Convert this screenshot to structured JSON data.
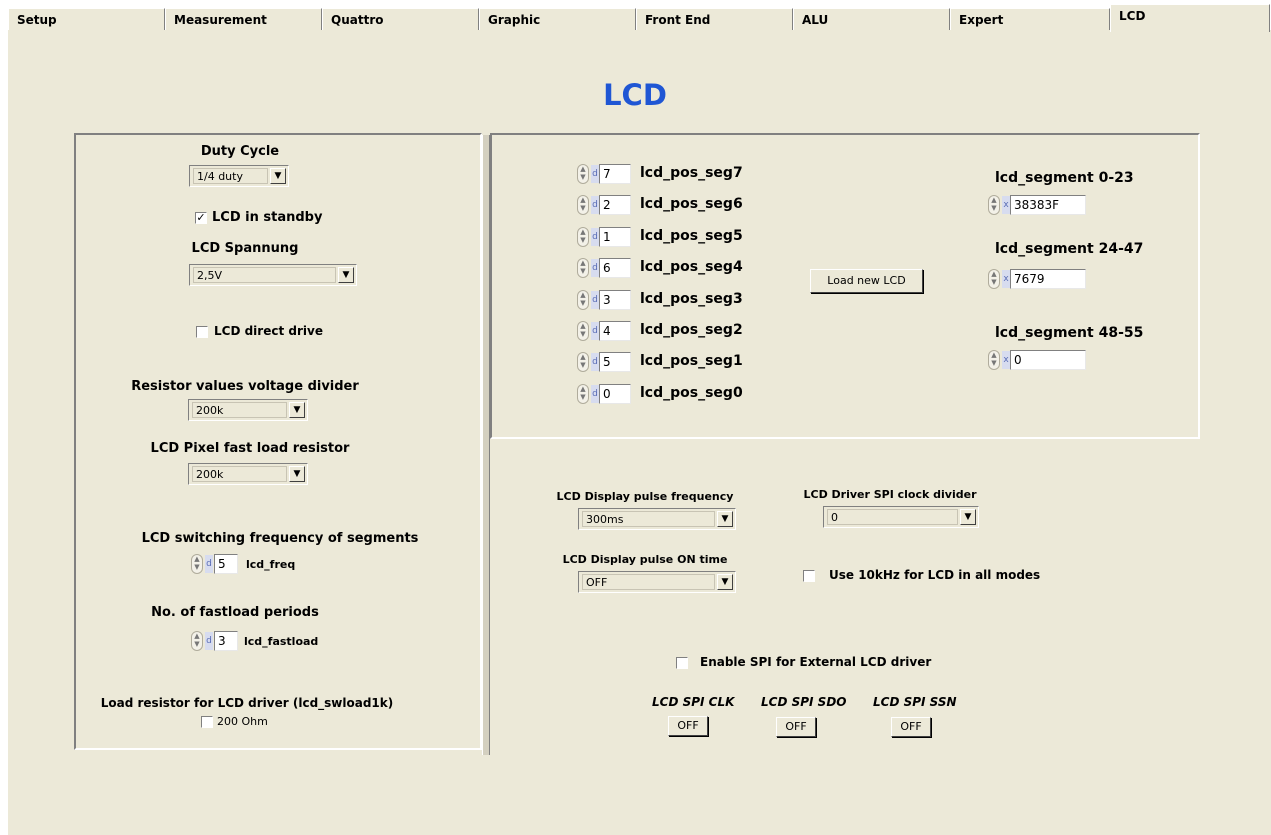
{
  "tabs": [
    {
      "label": "Setup"
    },
    {
      "label": "Measurement"
    },
    {
      "label": "Quattro"
    },
    {
      "label": "Graphic"
    },
    {
      "label": "Front End"
    },
    {
      "label": "ALU"
    },
    {
      "label": "Expert"
    },
    {
      "label": "LCD"
    }
  ],
  "page_title": "LCD",
  "left": {
    "duty_cycle_label": "Duty Cycle",
    "duty_cycle_value": "1/4 duty",
    "standby_label": "LCD in standby",
    "spannung_label": "LCD Spannung",
    "spannung_value": "2,5V",
    "direct_drive_label": "LCD direct drive",
    "resistor_label": "Resistor values voltage divider",
    "resistor_value": "200k",
    "fastload_res_label": "LCD Pixel fast load resistor",
    "fastload_res_value": "200k",
    "switch_freq_label": "LCD switching frequency of segments",
    "freq_value": "5",
    "freq_name": "lcd_freq",
    "fastload_periods_label": "No. of fastload periods",
    "fastload_value": "3",
    "fastload_name": "lcd_fastload",
    "load_res_label": "Load resistor for LCD driver (lcd_swload1k)",
    "ohm_label": "200 Ohm"
  },
  "segments": [
    {
      "value": "7",
      "name": "lcd_pos_seg7"
    },
    {
      "value": "2",
      "name": "lcd_pos_seg6"
    },
    {
      "value": "1",
      "name": "lcd_pos_seg5"
    },
    {
      "value": "6",
      "name": "lcd_pos_seg4"
    },
    {
      "value": "3",
      "name": "lcd_pos_seg3"
    },
    {
      "value": "4",
      "name": "lcd_pos_seg2"
    },
    {
      "value": "5",
      "name": "lcd_pos_seg1"
    },
    {
      "value": "0",
      "name": "lcd_pos_seg0"
    }
  ],
  "radix_dec": "d",
  "radix_hex": "x",
  "load_button": "Load new LCD",
  "seg_regs": [
    {
      "label": "lcd_segment 0-23",
      "value": "38383F"
    },
    {
      "label": "lcd_segment 24-47",
      "value": "7679"
    },
    {
      "label": "lcd_segment 48-55",
      "value": "0"
    }
  ],
  "lower": {
    "pulse_freq_label": "LCD Display pulse frequency",
    "pulse_freq_value": "300ms",
    "spi_div_label": "LCD Driver SPI clock divider",
    "spi_div_value": "0",
    "pulse_on_label": "LCD Display pulse ON time",
    "pulse_on_value": "OFF",
    "use10k_label": "Use 10kHz for LCD in all modes",
    "enable_spi_label": "Enable SPI for External LCD driver",
    "spi_clk_label": "LCD SPI CLK",
    "spi_sdo_label": "LCD SPI SDO",
    "spi_ssn_label": "LCD SPI SSN",
    "off_label": "OFF"
  }
}
